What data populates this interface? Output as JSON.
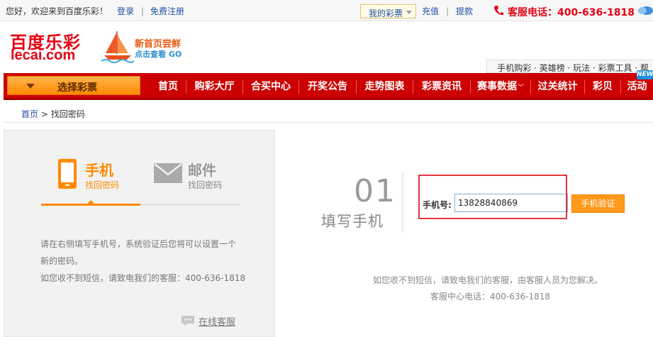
{
  "topbar": {
    "welcome": "您好，欢迎来到百度乐彩！",
    "login": "登录",
    "register": "免费注册",
    "my_lottery": "我的彩票",
    "recharge": "充值",
    "withdraw": "提款",
    "hotline": "客服电话：400-636-1818"
  },
  "logo": {
    "cn": "百度乐彩",
    "en": "lecai.com"
  },
  "promo": {
    "line1": "新首页尝鲜",
    "line2": "点击查看 GO"
  },
  "sublinks": "手机购彩 · 英雄榜 · 玩法 · 彩票工具 · 帮",
  "nav": {
    "select": "选择彩票",
    "items": [
      "首页",
      "购彩大厅",
      "合买中心",
      "开奖公告",
      "走势图表",
      "彩票资讯",
      "赛事数据",
      "过关统计",
      "彩贝",
      "活动"
    ],
    "new_badge": "NEW"
  },
  "breadcrumb": {
    "home": "首页",
    "separator": ">",
    "current": "找回密码"
  },
  "left": {
    "tab_phone": {
      "title": "手机",
      "sub": "找回密码"
    },
    "tab_mail": {
      "title": "邮件",
      "sub": "找回密码"
    },
    "desc_line1": "请在右侧填写手机号，系统验证后您将可以设置一个",
    "desc_line2": "新的密码。",
    "desc_line3": "如您收不到短信，请致电我们的客服：400-636-1818",
    "online_service": "在线客服"
  },
  "step": {
    "number": "01",
    "title": "填写手机"
  },
  "form": {
    "phone_label": "手机号:",
    "phone_value": "13828840869",
    "verify_button": "手机验证"
  },
  "help": {
    "line1": "如您收不到短信，请致电我们的客服，由客服人员为您解决。",
    "line2": "客服中心电话：400-636-1818"
  },
  "colors": {
    "brand_red": "#cc0000",
    "accent_orange": "#ff8a00",
    "link_blue": "#1e50a2",
    "highlight_box": "#e3343d"
  }
}
